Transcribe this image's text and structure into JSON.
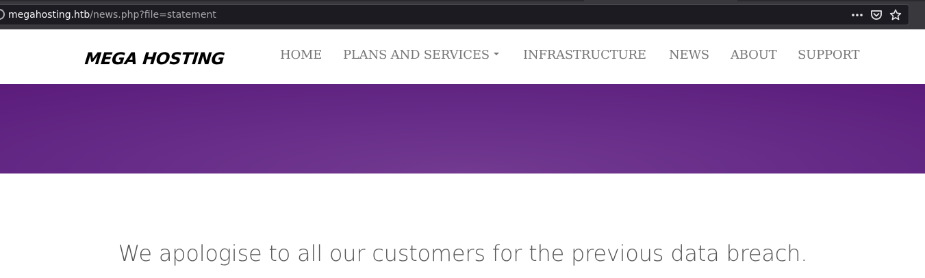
{
  "browser": {
    "url_host": "megahosting.htb",
    "url_path": "/news.php?file=statement",
    "actions": [
      {
        "icon": "more-icon",
        "glyph": "•••"
      },
      {
        "icon": "pocket-icon",
        "glyph": "⛉"
      },
      {
        "icon": "bookmark-star-icon",
        "glyph": "☆"
      }
    ]
  },
  "site": {
    "logo": "MEGA HOSTING",
    "nav": [
      {
        "label": "HOME"
      },
      {
        "label": "PLANS AND SERVICES"
      },
      {
        "label": "INFRASTRUCTURE"
      },
      {
        "label": "NEWS"
      },
      {
        "label": "ABOUT"
      },
      {
        "label": "SUPPORT"
      }
    ],
    "banner_color": "#662c88",
    "nav_color": "#777777"
  },
  "content": {
    "statement": "We apologise to all our customers for the previous data breach."
  }
}
